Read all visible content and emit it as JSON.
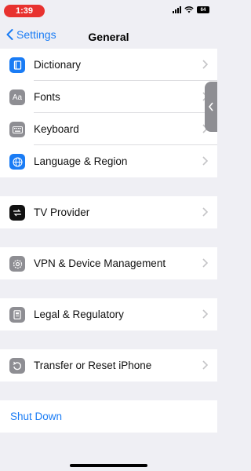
{
  "status": {
    "time": "1:39",
    "battery": "64"
  },
  "nav": {
    "back_label": "Settings",
    "title": "General"
  },
  "group1": [
    {
      "label": "Dictionary",
      "icon": "book-icon",
      "color": "#1a7cf5"
    },
    {
      "label": "Fonts",
      "icon": "fonts-icon",
      "color": "#8e8e93",
      "glyph": "Aa"
    },
    {
      "label": "Keyboard",
      "icon": "keyboard-icon",
      "color": "#8e8e93"
    },
    {
      "label": "Language & Region",
      "icon": "globe-icon",
      "color": "#1a7cf5"
    }
  ],
  "group2": [
    {
      "label": "TV Provider",
      "icon": "tv-provider-icon",
      "color": "#111111"
    }
  ],
  "group3": [
    {
      "label": "VPN & Device Management",
      "icon": "gear-icon",
      "color": "#8e8e93"
    }
  ],
  "group4": [
    {
      "label": "Legal & Regulatory",
      "icon": "legal-icon",
      "color": "#8e8e93"
    }
  ],
  "group5": [
    {
      "label": "Transfer or Reset iPhone",
      "icon": "reset-icon",
      "color": "#8e8e93"
    }
  ],
  "shutdown": {
    "label": "Shut Down"
  },
  "colors": {
    "accent": "#1a7cf5",
    "time_pill": "#e8322f"
  }
}
